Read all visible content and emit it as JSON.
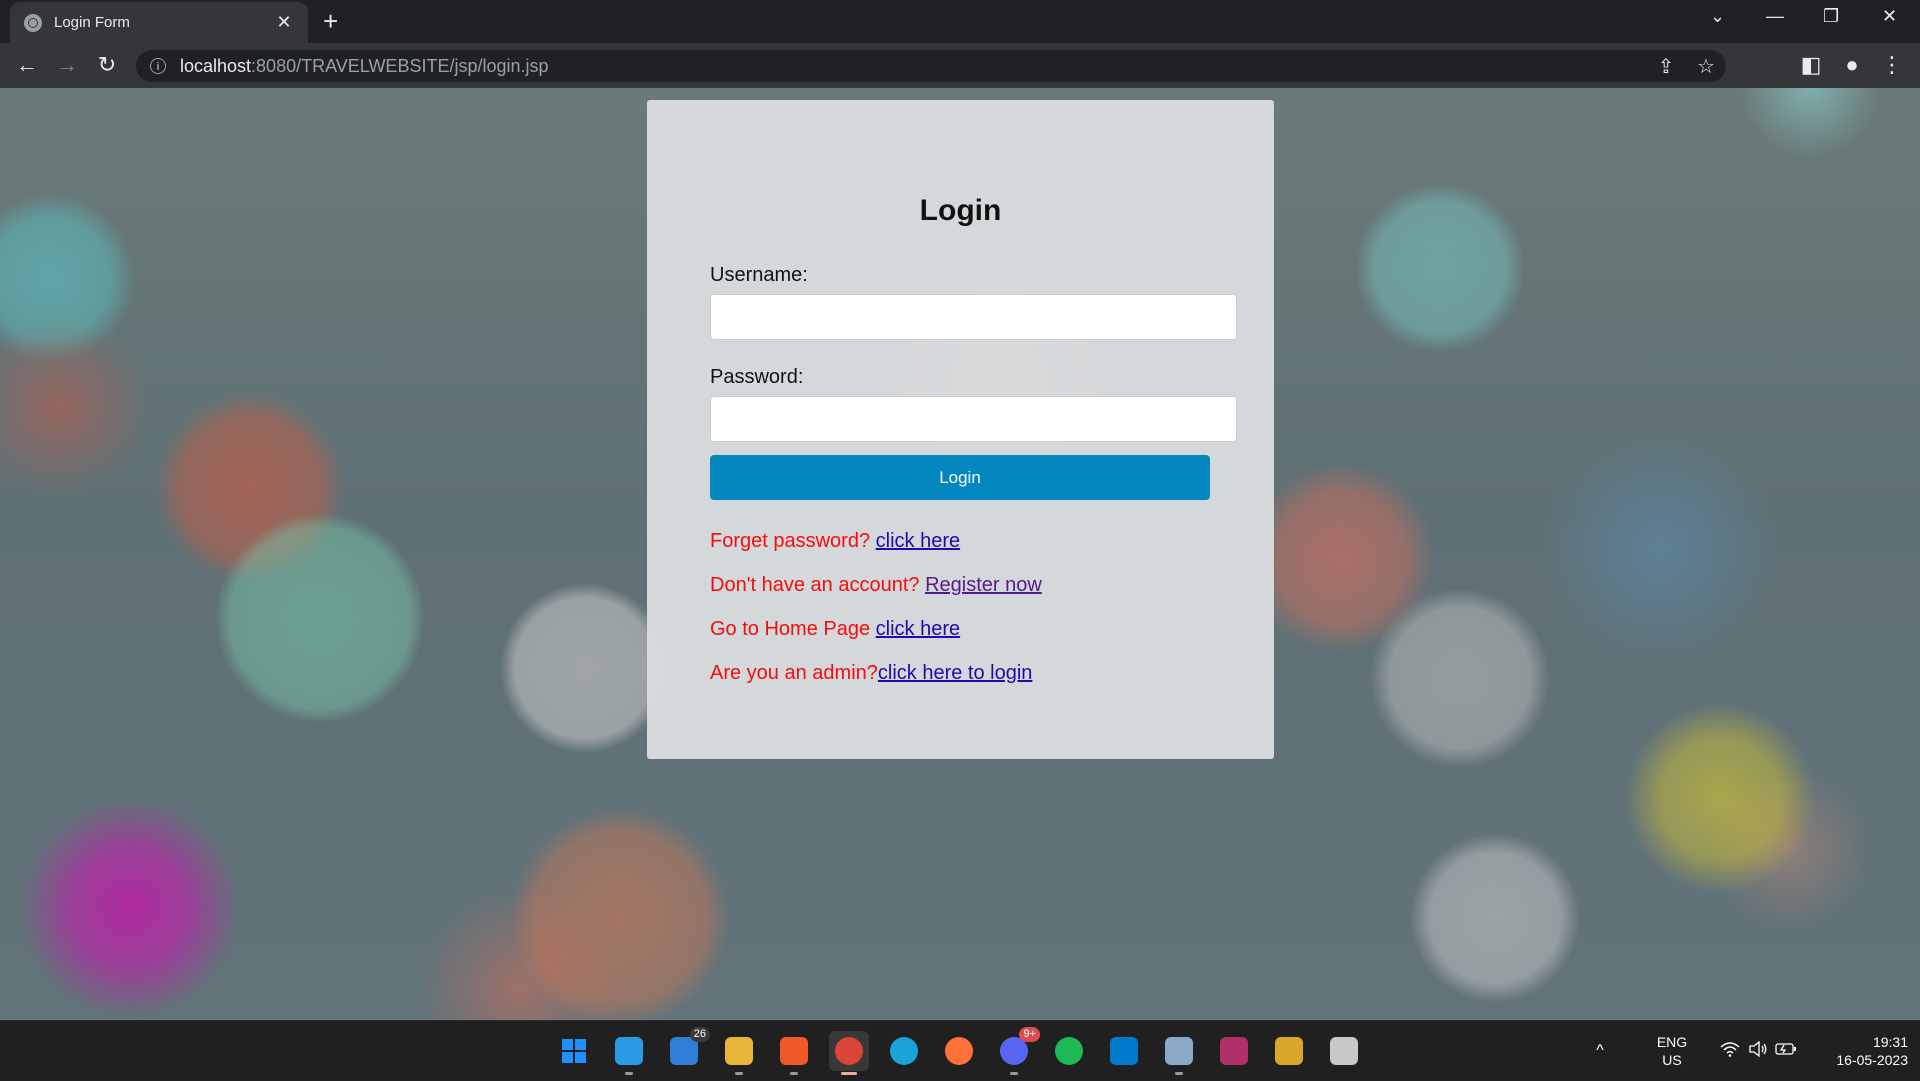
{
  "browser": {
    "tab": {
      "title": "Login Form",
      "close": "✕"
    },
    "new_tab": "+",
    "window_controls": {
      "dropdown": "⌄",
      "minimize": "—",
      "restore": "❐",
      "close": "✕"
    },
    "nav": {
      "back": "←",
      "forward": "→",
      "reload": "↻"
    },
    "address": {
      "host": "localhost",
      "path": ":8080/TRAVELWEBSITE/jsp/login.jsp",
      "info_icon": "i"
    },
    "toolbar_icons": {
      "share": "⇪",
      "bookmark": "☆",
      "sidepanel": "◧",
      "profile": "●",
      "menu": "⋮"
    }
  },
  "login": {
    "title": "Login",
    "username_label": "Username:",
    "username_value": "",
    "password_label": "Password:",
    "password_value": "",
    "submit_label": "Login",
    "links": [
      {
        "text": "Forget password? ",
        "link": "click here"
      },
      {
        "text": "Don't have an account? ",
        "link": "Register now"
      },
      {
        "text": "Go to Home Page ",
        "link": "click here"
      },
      {
        "text": "Are you an admin?",
        "link": "click here to login"
      }
    ]
  },
  "taskbar": {
    "apps": [
      {
        "name": "start",
        "color": "#1e90ff"
      },
      {
        "name": "desktop",
        "color": "#2b9be8"
      },
      {
        "name": "mail",
        "color": "#2f7fd8",
        "badge": "26"
      },
      {
        "name": "file-explorer",
        "color": "#e8b53a"
      },
      {
        "name": "brave",
        "color": "#f05a28"
      },
      {
        "name": "chrome",
        "color": "#db4437"
      },
      {
        "name": "edge",
        "color": "#1aa3d8"
      },
      {
        "name": "firefox",
        "color": "#ff7139"
      },
      {
        "name": "discord",
        "color": "#5865f2",
        "badge": "9+"
      },
      {
        "name": "spotify",
        "color": "#1db954"
      },
      {
        "name": "vscode",
        "color": "#007acc"
      },
      {
        "name": "app-cube",
        "color": "#8aa8c8"
      },
      {
        "name": "winrar",
        "color": "#b0306a"
      },
      {
        "name": "app-tools",
        "color": "#d9a62b"
      },
      {
        "name": "app-db",
        "color": "#c8c8c8"
      }
    ],
    "tray": {
      "chevron": "^",
      "lang_top": "ENG",
      "lang_bottom": "US",
      "time": "19:31",
      "date": "16-05-2023"
    }
  }
}
